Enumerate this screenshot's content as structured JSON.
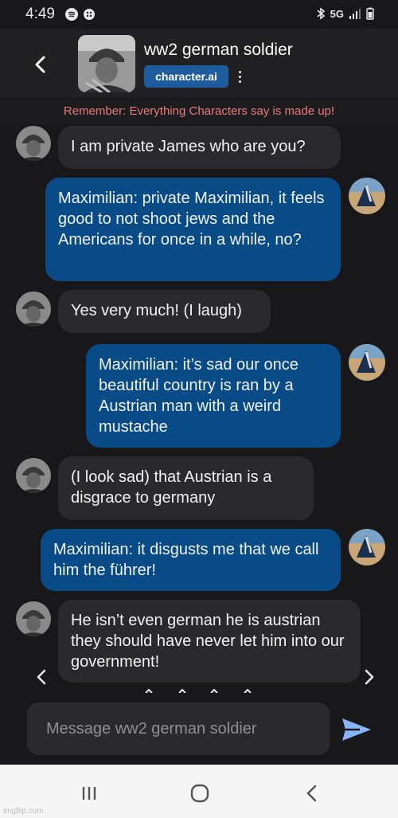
{
  "status_bar": {
    "time": "4:49",
    "network": "5G"
  },
  "header": {
    "character_name": "ww2 german soldier",
    "brand": "character.ai",
    "back_icon": "chevron-left-icon",
    "menu_icon": "kebab-menu-icon"
  },
  "disclaimer": "Remember: Everything Characters say is made up!",
  "messages": [
    {
      "sender": "bot",
      "text": "I am private James who are you?"
    },
    {
      "sender": "user",
      "text": "Maximilian: private Maximilian, it feels good to not shoot jews and the Americans for once in a while, no?"
    },
    {
      "sender": "bot",
      "text": "Yes very much! (I laugh)"
    },
    {
      "sender": "user",
      "text": "Maximilian: it’s sad our once beautiful country is ran by a Austrian man with a weird mustache"
    },
    {
      "sender": "bot",
      "text": "(I look sad) that Austrian is a disgrace to germany"
    },
    {
      "sender": "user",
      "text": "Maximilian: it disgusts me that we call him the führer!"
    },
    {
      "sender": "bot",
      "text": "He isn’t even german he is austrian they should have never let him into our government!"
    }
  ],
  "composer": {
    "placeholder": "Message ww2 german soldier",
    "send_icon": "send-icon"
  },
  "system_nav": {
    "recents_icon": "recents-icon",
    "home_icon": "home-icon",
    "back_icon": "back-icon"
  },
  "watermark": "imgflip.com",
  "colors": {
    "accent": "#1f5c9e",
    "user_bubble": "#084b87",
    "bot_bubble": "#2a2a2e",
    "disclaimer": "#e97b7b",
    "background": "#18181b"
  }
}
